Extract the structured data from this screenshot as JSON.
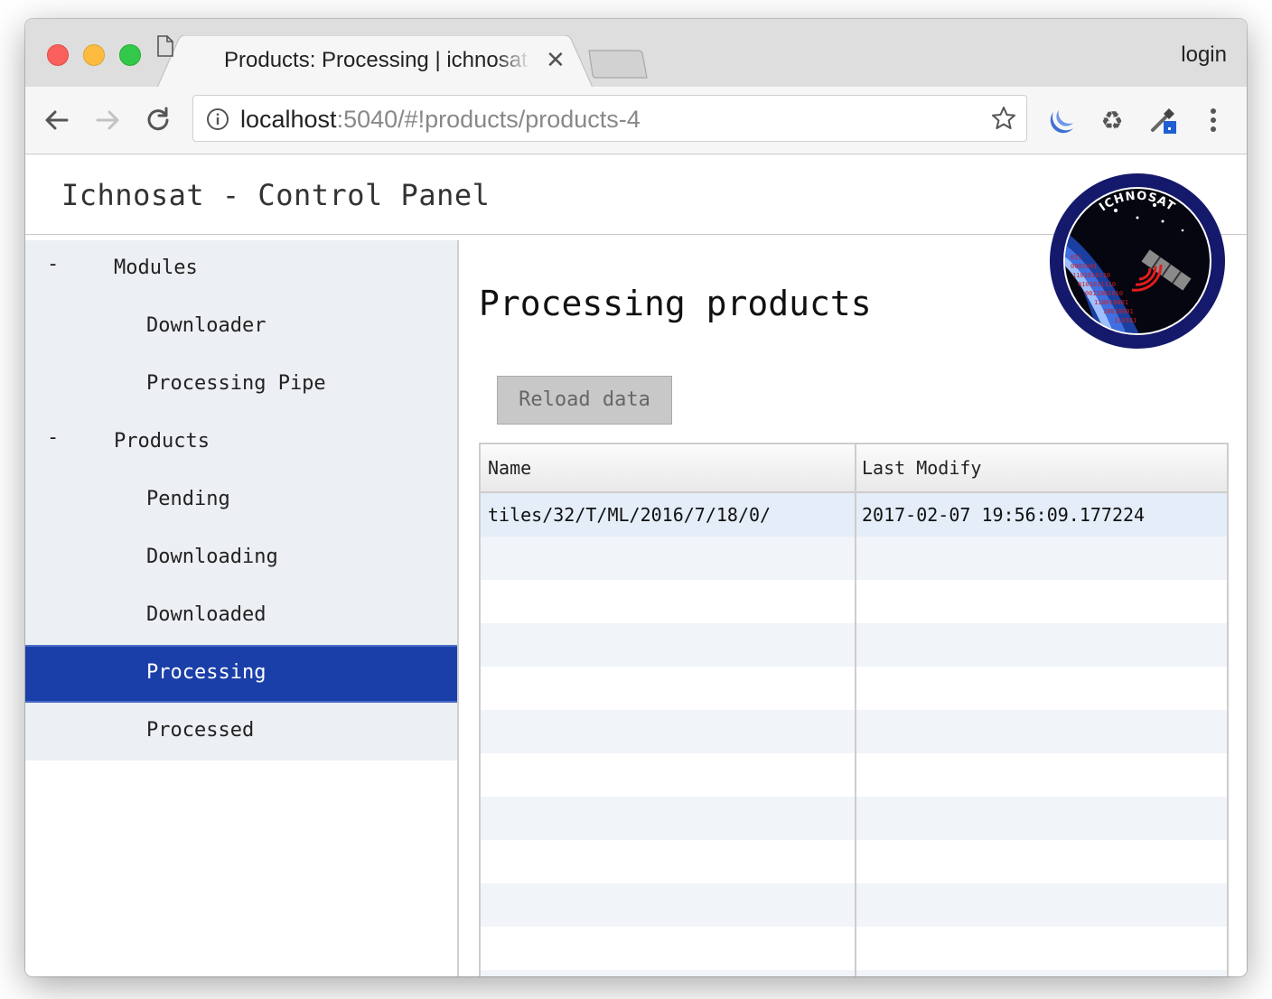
{
  "browser": {
    "tab_title": "Products: Processing | ichnosat",
    "login_label": "login",
    "url_host": "localhost",
    "url_rest": ":5040/#!products/products-4"
  },
  "app": {
    "title": "Ichnosat - Control Panel",
    "logo_text": "ICHNOSAT"
  },
  "sidebar": {
    "groups": [
      {
        "toggle": "-",
        "label": "Modules",
        "items": [
          "Downloader",
          "Processing Pipe"
        ]
      },
      {
        "toggle": "-",
        "label": "Products",
        "items": [
          "Pending",
          "Downloading",
          "Downloaded",
          "Processing",
          "Processed"
        ]
      }
    ],
    "active_item": "Processing"
  },
  "main": {
    "title": "Processing products",
    "reload_label": "Reload data",
    "table": {
      "columns": [
        "Name",
        "Last Modify"
      ],
      "rows": [
        [
          "tiles/32/T/ML/2016/7/18/0/",
          "2017-02-07 19:56:09.177224"
        ]
      ]
    }
  },
  "colors": {
    "active_menu": "#1b3fa9",
    "menu_bg": "#eceff3",
    "logo_ring": "#14196b"
  }
}
